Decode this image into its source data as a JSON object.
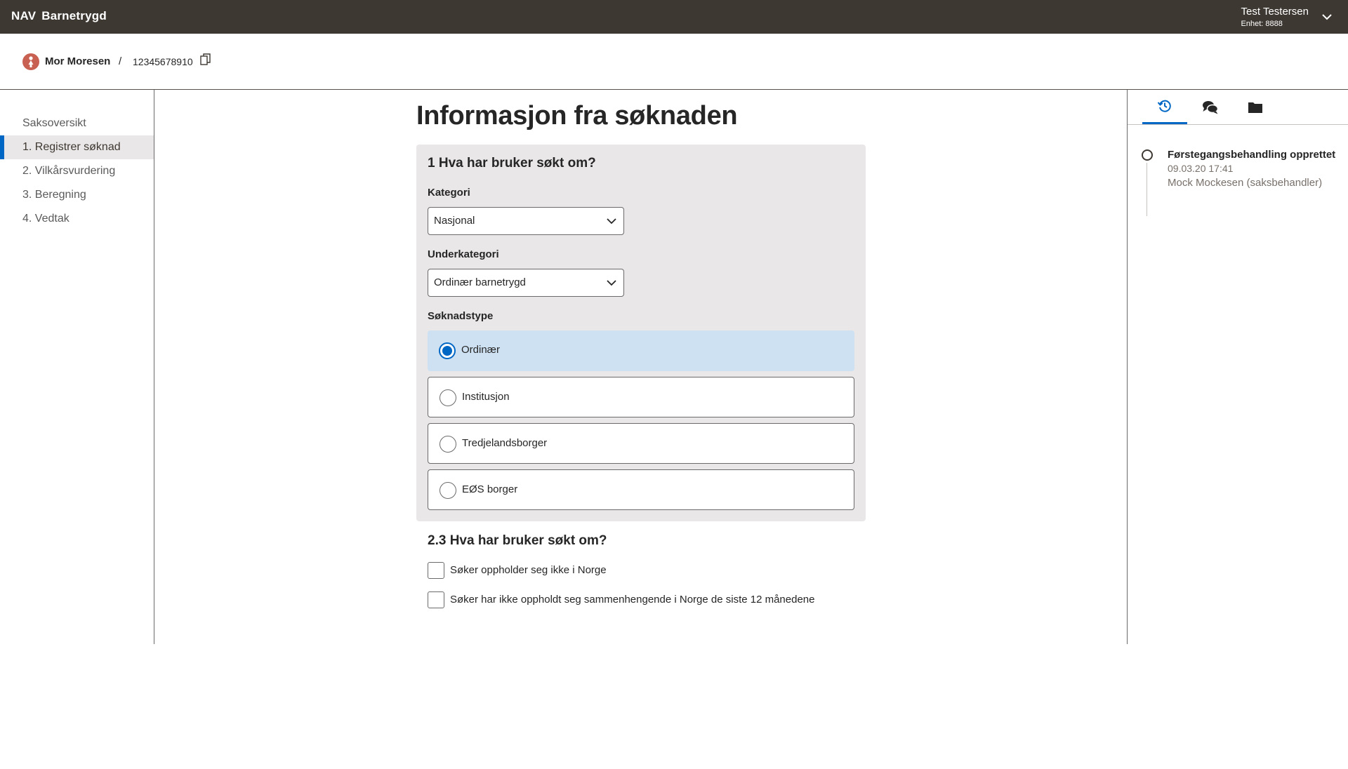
{
  "header": {
    "brand_nav": "NAV",
    "brand_app": "Barnetrygd",
    "user_name": "Test Testersen",
    "user_unit": "Enhet: 8888"
  },
  "person": {
    "name": "Mor Moresen",
    "separator": "/",
    "id": "12345678910"
  },
  "menu": {
    "items": [
      {
        "label": "Saksoversikt",
        "active": false
      },
      {
        "label": "1. Registrer søknad",
        "active": true
      },
      {
        "label": "2. Vilkårsvurdering",
        "active": false
      },
      {
        "label": "3. Beregning",
        "active": false
      },
      {
        "label": "4. Vedtak",
        "active": false
      }
    ]
  },
  "main": {
    "title": "Informasjon fra søknaden",
    "section1_title": "1 Hva har bruker søkt om?",
    "kategori_label": "Kategori",
    "kategori_value": "Nasjonal",
    "underkategori_label": "Underkategori",
    "underkategori_value": "Ordinær barnetrygd",
    "soknadstype_label": "Søknadstype",
    "soknadstype_options": [
      {
        "label": "Ordinær",
        "checked": true
      },
      {
        "label": "Institusjon",
        "checked": false
      },
      {
        "label": "Tredjelandsborger",
        "checked": false
      },
      {
        "label": "EØS borger",
        "checked": false
      }
    ],
    "section2_title": "2.3 Hva har bruker søkt om?",
    "checkboxes": [
      {
        "label": "Søker oppholder seg ikke i Norge",
        "checked": false
      },
      {
        "label": "Søker har ikke oppholdt seg sammenhengende i Norge de siste 12 månedene",
        "checked": false
      }
    ]
  },
  "history": {
    "title": "Førstegangsbehandling opprettet",
    "date": "09.03.20 17:41",
    "user": "Mock Mockesen (saksbehandler)"
  },
  "colors": {
    "header_bg": "#3e3832",
    "accent": "#0067c5",
    "panel_bg": "#e9e7e7",
    "selected_radio_bg": "#cde1f3",
    "person_icon": "#c86151"
  }
}
